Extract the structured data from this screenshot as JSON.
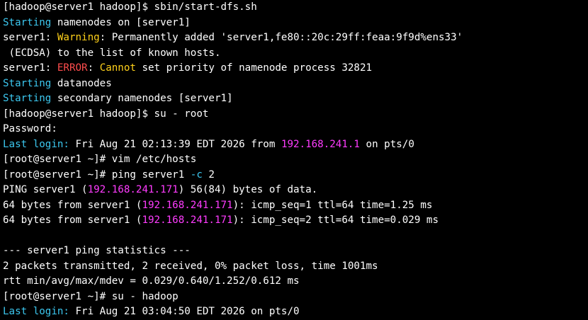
{
  "window": {
    "title": "",
    "background": "#000000"
  },
  "colors": {
    "default": "#ffffff",
    "cyan": "#3cc8f0",
    "yellow": "#ffd11a",
    "red": "#ff4d4d",
    "magenta": "#ff3cff"
  },
  "lines": [
    [
      {
        "text": "[hadoop@server1 hadoop]$ sbin/start-dfs.sh",
        "color": "default"
      }
    ],
    [
      {
        "text": "Starting",
        "color": "cyan"
      },
      {
        "text": " namenodes on [server1]",
        "color": "default"
      }
    ],
    [
      {
        "text": "server1: ",
        "color": "default"
      },
      {
        "text": "Warning",
        "color": "yellow"
      },
      {
        "text": ": Permanently added 'server1,fe80::20c:29ff:feaa:9f9d%ens33'",
        "color": "default"
      }
    ],
    [
      {
        "text": " (ECDSA) to the list of known hosts.",
        "color": "default"
      }
    ],
    [
      {
        "text": "server1: ",
        "color": "default"
      },
      {
        "text": "ERROR",
        "color": "red"
      },
      {
        "text": ": ",
        "color": "default"
      },
      {
        "text": "Cannot",
        "color": "yellow"
      },
      {
        "text": " set priority of namenode process 32821",
        "color": "default"
      }
    ],
    [
      {
        "text": "Starting",
        "color": "cyan"
      },
      {
        "text": " datanodes",
        "color": "default"
      }
    ],
    [
      {
        "text": "Starting",
        "color": "cyan"
      },
      {
        "text": " secondary namenodes [server1]",
        "color": "default"
      }
    ],
    [
      {
        "text": "[hadoop@server1 hadoop]$ su - root",
        "color": "default"
      }
    ],
    [
      {
        "text": "Password:",
        "color": "default"
      }
    ],
    [
      {
        "text": "Last login:",
        "color": "cyan"
      },
      {
        "text": " Fri Aug 21 02:13:39 EDT 2026 from ",
        "color": "default"
      },
      {
        "text": "192.168.241.1",
        "color": "magenta"
      },
      {
        "text": " on pts/0",
        "color": "default"
      }
    ],
    [
      {
        "text": "[root@server1 ~]# vim /etc/hosts",
        "color": "default"
      }
    ],
    [
      {
        "text": "[root@server1 ~]# ping server1 ",
        "color": "default"
      },
      {
        "text": "-c",
        "color": "cyan"
      },
      {
        "text": " 2",
        "color": "default"
      }
    ],
    [
      {
        "text": "PING server1 (",
        "color": "default"
      },
      {
        "text": "192.168.241.171",
        "color": "magenta"
      },
      {
        "text": ") 56(84) bytes of data.",
        "color": "default"
      }
    ],
    [
      {
        "text": "64 bytes from server1 (",
        "color": "default"
      },
      {
        "text": "192.168.241.171",
        "color": "magenta"
      },
      {
        "text": "): icmp_seq=1 ttl=64 time=1.25 ms",
        "color": "default"
      }
    ],
    [
      {
        "text": "64 bytes from server1 (",
        "color": "default"
      },
      {
        "text": "192.168.241.171",
        "color": "magenta"
      },
      {
        "text": "): icmp_seq=2 ttl=64 time=0.029 ms",
        "color": "default"
      }
    ],
    [
      {
        "text": "",
        "color": "default"
      }
    ],
    [
      {
        "text": "--- server1 ping statistics ---",
        "color": "default"
      }
    ],
    [
      {
        "text": "2 packets transmitted, 2 received, 0% packet loss, time 1001ms",
        "color": "default"
      }
    ],
    [
      {
        "text": "rtt min/avg/max/mdev = 0.029/0.640/1.252/0.612 ms",
        "color": "default"
      }
    ],
    [
      {
        "text": "[root@server1 ~]# su - hadoop",
        "color": "default"
      }
    ],
    [
      {
        "text": "Last login:",
        "color": "cyan"
      },
      {
        "text": " Fri Aug 21 03:04:50 EDT 2026 on pts/0",
        "color": "default"
      }
    ]
  ]
}
